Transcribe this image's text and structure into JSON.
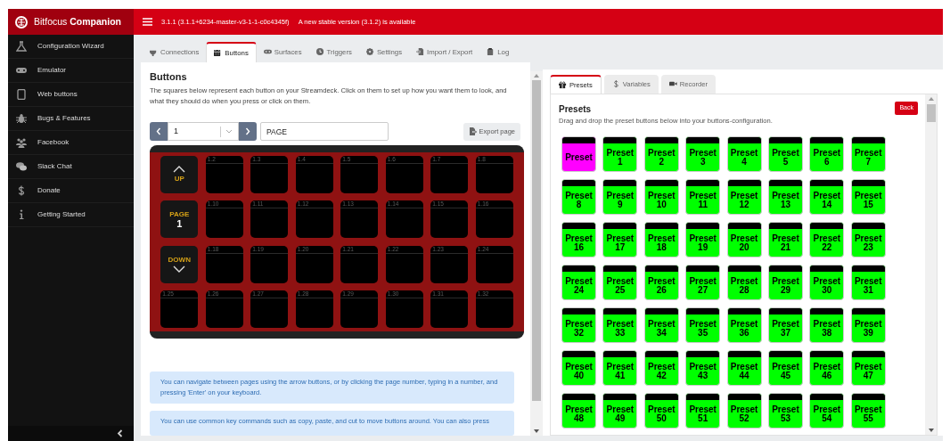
{
  "brand": "Bitfocus **Companion**",
  "version_text": "3.1.1 (3.1.1+6234-master-v3-1-1-c0c4345f)",
  "update_notice": "A new stable version (3.1.2) is available",
  "sidebar": {
    "items": [
      {
        "label": "Configuration Wizard"
      },
      {
        "label": "Emulator"
      },
      {
        "label": "Web buttons"
      },
      {
        "label": "Bugs & Features"
      },
      {
        "label": "Facebook"
      },
      {
        "label": "Slack Chat"
      },
      {
        "label": "Donate"
      },
      {
        "label": "Getting Started"
      }
    ]
  },
  "tabs": [
    {
      "label": "Connections",
      "selected": false
    },
    {
      "label": "Buttons",
      "selected": true
    },
    {
      "label": "Surfaces",
      "selected": false
    },
    {
      "label": "Triggers",
      "selected": false
    },
    {
      "label": "Settings",
      "selected": false
    },
    {
      "label": "Import / Export",
      "selected": false
    },
    {
      "label": "Log",
      "selected": false
    }
  ],
  "buttons_panel": {
    "title": "Buttons",
    "description": "The squares below represent each button on your Streamdeck. Click on them to set up how you want them to look, and what they should do when you press or click on them.",
    "page_number": "1",
    "page_name": "PAGE",
    "export_button": "Export page",
    "keys": [
      {
        "kind": "up",
        "label": "UP"
      },
      {
        "kind": "blank",
        "number": "1.2"
      },
      {
        "kind": "blank",
        "number": "1.3"
      },
      {
        "kind": "blank",
        "number": "1.4"
      },
      {
        "kind": "blank",
        "number": "1.5"
      },
      {
        "kind": "blank",
        "number": "1.6"
      },
      {
        "kind": "blank",
        "number": "1.7"
      },
      {
        "kind": "blank",
        "number": "1.8"
      },
      {
        "kind": "page",
        "label": "PAGE",
        "value": "1"
      },
      {
        "kind": "blank",
        "number": "1.10"
      },
      {
        "kind": "blank",
        "number": "1.11"
      },
      {
        "kind": "blank",
        "number": "1.12"
      },
      {
        "kind": "blank",
        "number": "1.13"
      },
      {
        "kind": "blank",
        "number": "1.14"
      },
      {
        "kind": "blank",
        "number": "1.15"
      },
      {
        "kind": "blank",
        "number": "1.16"
      },
      {
        "kind": "down",
        "label": "DOWN"
      },
      {
        "kind": "blank",
        "number": "1.18"
      },
      {
        "kind": "blank",
        "number": "1.19"
      },
      {
        "kind": "blank",
        "number": "1.20"
      },
      {
        "kind": "blank",
        "number": "1.21"
      },
      {
        "kind": "blank",
        "number": "1.22"
      },
      {
        "kind": "blank",
        "number": "1.23"
      },
      {
        "kind": "blank",
        "number": "1.24"
      },
      {
        "kind": "blank",
        "number": "1.25"
      },
      {
        "kind": "blank",
        "number": "1.26"
      },
      {
        "kind": "blank",
        "number": "1.27"
      },
      {
        "kind": "blank",
        "number": "1.28"
      },
      {
        "kind": "blank",
        "number": "1.29"
      },
      {
        "kind": "blank",
        "number": "1.30"
      },
      {
        "kind": "blank",
        "number": "1.31"
      },
      {
        "kind": "blank",
        "number": "1.32"
      }
    ],
    "tips": [
      "You can navigate between pages using the arrow buttons, or by clicking the page number, typing in a number, and pressing 'Enter' on your keyboard.",
      "You can use common key commands such as copy, paste, and cut to move buttons around. You can also press"
    ]
  },
  "right_tabs": [
    {
      "label": "Presets",
      "selected": true
    },
    {
      "label": "Variables",
      "selected": false
    },
    {
      "label": "Recorder",
      "selected": false
    }
  ],
  "presets_panel": {
    "title": "Presets",
    "description": "Drag and drop the preset buttons below into your buttons-configuration.",
    "back_button": "Back",
    "presets": [
      {
        "label": "Preset",
        "color": "#ff00ff"
      },
      {
        "label": "Preset 1",
        "color": "#00ff00"
      },
      {
        "label": "Preset 2",
        "color": "#00ff00"
      },
      {
        "label": "Preset 3",
        "color": "#00ff00"
      },
      {
        "label": "Preset 4",
        "color": "#00ff00"
      },
      {
        "label": "Preset 5",
        "color": "#00ff00"
      },
      {
        "label": "Preset 6",
        "color": "#00ff00"
      },
      {
        "label": "Preset 7",
        "color": "#00ff00"
      },
      {
        "label": "Preset 8",
        "color": "#00ff00"
      },
      {
        "label": "Preset 9",
        "color": "#00ff00"
      },
      {
        "label": "Preset 10",
        "color": "#00ff00"
      },
      {
        "label": "Preset 11",
        "color": "#00ff00"
      },
      {
        "label": "Preset 12",
        "color": "#00ff00"
      },
      {
        "label": "Preset 13",
        "color": "#00ff00"
      },
      {
        "label": "Preset 14",
        "color": "#00ff00"
      },
      {
        "label": "Preset 15",
        "color": "#00ff00"
      },
      {
        "label": "Preset 16",
        "color": "#00ff00"
      },
      {
        "label": "Preset 17",
        "color": "#00ff00"
      },
      {
        "label": "Preset 18",
        "color": "#00ff00"
      },
      {
        "label": "Preset 19",
        "color": "#00ff00"
      },
      {
        "label": "Preset 20",
        "color": "#00ff00"
      },
      {
        "label": "Preset 21",
        "color": "#00ff00"
      },
      {
        "label": "Preset 22",
        "color": "#00ff00"
      },
      {
        "label": "Preset 23",
        "color": "#00ff00"
      },
      {
        "label": "Preset 24",
        "color": "#00ff00"
      },
      {
        "label": "Preset 25",
        "color": "#00ff00"
      },
      {
        "label": "Preset 26",
        "color": "#00ff00"
      },
      {
        "label": "Preset 27",
        "color": "#00ff00"
      },
      {
        "label": "Preset 28",
        "color": "#00ff00"
      },
      {
        "label": "Preset 29",
        "color": "#00ff00"
      },
      {
        "label": "Preset 30",
        "color": "#00ff00"
      },
      {
        "label": "Preset 31",
        "color": "#00ff00"
      },
      {
        "label": "Preset 32",
        "color": "#00ff00"
      },
      {
        "label": "Preset 33",
        "color": "#00ff00"
      },
      {
        "label": "Preset 34",
        "color": "#00ff00"
      },
      {
        "label": "Preset 35",
        "color": "#00ff00"
      },
      {
        "label": "Preset 36",
        "color": "#00ff00"
      },
      {
        "label": "Preset 37",
        "color": "#00ff00"
      },
      {
        "label": "Preset 38",
        "color": "#00ff00"
      },
      {
        "label": "Preset 39",
        "color": "#00ff00"
      },
      {
        "label": "Preset 40",
        "color": "#00ff00"
      },
      {
        "label": "Preset 41",
        "color": "#00ff00"
      },
      {
        "label": "Preset 42",
        "color": "#00ff00"
      },
      {
        "label": "Preset 43",
        "color": "#00ff00"
      },
      {
        "label": "Preset 44",
        "color": "#00ff00"
      },
      {
        "label": "Preset 45",
        "color": "#00ff00"
      },
      {
        "label": "Preset 46",
        "color": "#00ff00"
      },
      {
        "label": "Preset 47",
        "color": "#00ff00"
      },
      {
        "label": "Preset 48",
        "color": "#00ff00"
      },
      {
        "label": "Preset 49",
        "color": "#00ff00"
      },
      {
        "label": "Preset 50",
        "color": "#00ff00"
      },
      {
        "label": "Preset 51",
        "color": "#00ff00"
      },
      {
        "label": "Preset 52",
        "color": "#00ff00"
      },
      {
        "label": "Preset 53",
        "color": "#00ff00"
      },
      {
        "label": "Preset 54",
        "color": "#00ff00"
      },
      {
        "label": "Preset 55",
        "color": "#00ff00"
      }
    ]
  }
}
